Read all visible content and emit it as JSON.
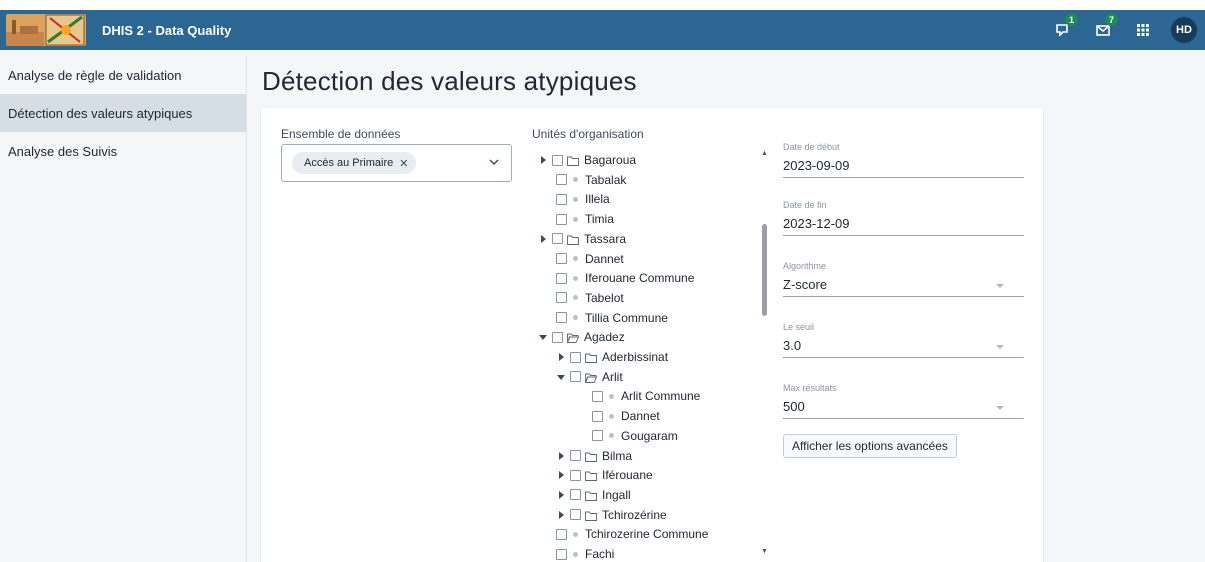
{
  "header": {
    "app_title": "DHIS 2 - Data Quality",
    "interpretations_count": "1",
    "messages_count": "7",
    "user_initials": "HD"
  },
  "sidebar": {
    "items": [
      {
        "label": "Analyse de règle de validation"
      },
      {
        "label": "Détection des valeurs atypiques"
      },
      {
        "label": "Analyse des Suivis"
      }
    ]
  },
  "main": {
    "title": "Détection des valeurs atypiques",
    "dataset_label": "Ensemble de données",
    "dataset_chip": "Accès au Primaire",
    "orgunit_label": "Unités d'organisation",
    "tree": [
      {
        "label": "Bagaroua",
        "type": "folder",
        "expanded": false,
        "level": 0
      },
      {
        "label": "Tabalak",
        "type": "leaf",
        "level": 0
      },
      {
        "label": "Illela",
        "type": "leaf",
        "level": 0
      },
      {
        "label": "Timia",
        "type": "leaf",
        "level": 0
      },
      {
        "label": "Tassara",
        "type": "folder",
        "expanded": false,
        "level": 0
      },
      {
        "label": "Dannet",
        "type": "leaf",
        "level": 0
      },
      {
        "label": "Iferouane Commune",
        "type": "leaf",
        "level": 0
      },
      {
        "label": "Tabelot",
        "type": "leaf",
        "level": 0
      },
      {
        "label": "Tillia Commune",
        "type": "leaf",
        "level": 0
      },
      {
        "label": "Agadez",
        "type": "folder",
        "expanded": true,
        "level": 0
      },
      {
        "label": "Aderbissinat",
        "type": "folder",
        "expanded": false,
        "level": 1
      },
      {
        "label": "Arlit",
        "type": "folder",
        "expanded": true,
        "level": 1
      },
      {
        "label": "Arlit Commune",
        "type": "leaf",
        "level": 2
      },
      {
        "label": "Dannet",
        "type": "leaf",
        "level": 2
      },
      {
        "label": "Gougaram",
        "type": "leaf",
        "level": 2
      },
      {
        "label": "Bilma",
        "type": "folder",
        "expanded": false,
        "level": 1
      },
      {
        "label": "Iférouane",
        "type": "folder",
        "expanded": false,
        "level": 1
      },
      {
        "label": "Ingall",
        "type": "folder",
        "expanded": false,
        "level": 1
      },
      {
        "label": "Tchirozérine",
        "type": "folder",
        "expanded": false,
        "level": 1
      },
      {
        "label": "Tchirozerine Commune",
        "type": "leaf",
        "level": 0
      },
      {
        "label": "Fachi",
        "type": "leaf",
        "level": 0
      }
    ],
    "fields": {
      "start_date": {
        "label": "Date de début",
        "value": "2023-09-09"
      },
      "end_date": {
        "label": "Date de fin",
        "value": "2023-12-09"
      },
      "algorithm": {
        "label": "Algorithme",
        "value": "Z-score"
      },
      "threshold": {
        "label": "Le seuil",
        "value": "3.0"
      },
      "max_results": {
        "label": "Max résultats",
        "value": "500"
      }
    },
    "advanced_button": "Afficher les options avancées"
  }
}
